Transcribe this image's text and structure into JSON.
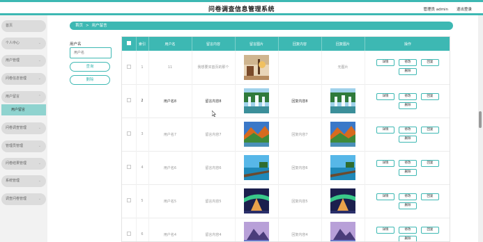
{
  "header": {
    "title": "问卷调查信息管理系统",
    "user": "管理员 admin",
    "logout": "退出登录"
  },
  "sidebar": {
    "items": [
      {
        "label": "首页",
        "chevron": false
      },
      {
        "label": "个人中心",
        "chevron": true
      },
      {
        "label": "用户管理",
        "chevron": true
      },
      {
        "label": "问卷信息管理",
        "chevron": true
      },
      {
        "label": "用户留言",
        "chevron": true
      },
      {
        "label": "问卷调查管理",
        "chevron": true
      },
      {
        "label": "管理员管理",
        "chevron": true
      },
      {
        "label": "问卷结果管理",
        "chevron": true
      },
      {
        "label": "系统管理",
        "chevron": true
      },
      {
        "label": "调查问卷管理",
        "chevron": true
      }
    ],
    "submenu": {
      "label": "用户留言"
    }
  },
  "breadcrumb": {
    "home": "首页",
    "separator": ">",
    "current": "用户留言"
  },
  "search": {
    "label": "用户名",
    "placeholder": "用户名",
    "query_button": "查询",
    "delete_button": "删除"
  },
  "table": {
    "headers": [
      "",
      "索引",
      "用户名",
      "留言内容",
      "留言图片",
      "回复内容",
      "回复图片",
      "操作"
    ],
    "actions": {
      "detail": "详情",
      "edit": "修改",
      "reply": "回复",
      "delete": "删除"
    },
    "rows": [
      {
        "index": "1",
        "username": "11",
        "message": "我想要买首页的那个",
        "reply": "",
        "reply_image_text": "无图片",
        "bold": false,
        "image": "shop",
        "reply_image": ""
      },
      {
        "index": "2",
        "username": "用户名8",
        "message": "留言内容8",
        "reply": "回复内容8",
        "reply_image_text": "",
        "bold": true,
        "image": "waterfall",
        "reply_image": "waterfall"
      },
      {
        "index": "3",
        "username": "用户名7",
        "message": "留言内容7",
        "reply": "回复内容7",
        "reply_image_text": "",
        "bold": false,
        "image": "autumn",
        "reply_image": "autumn"
      },
      {
        "index": "4",
        "username": "用户名6",
        "message": "留言内容6",
        "reply": "回复内容6",
        "reply_image_text": "",
        "bold": false,
        "image": "pier",
        "reply_image": "pier"
      },
      {
        "index": "5",
        "username": "用户名5",
        "message": "留言内容5",
        "reply": "回复内容5",
        "reply_image_text": "",
        "bold": false,
        "image": "aurora",
        "reply_image": "aurora"
      },
      {
        "index": "6",
        "username": "用户名4",
        "message": "留言内容4",
        "reply": "回复内容4",
        "reply_image_text": "",
        "bold": false,
        "image": "mountain",
        "reply_image": "mountain"
      }
    ]
  },
  "colors": {
    "accent": "#3db8b3",
    "accent_light": "#8fd3cf"
  }
}
